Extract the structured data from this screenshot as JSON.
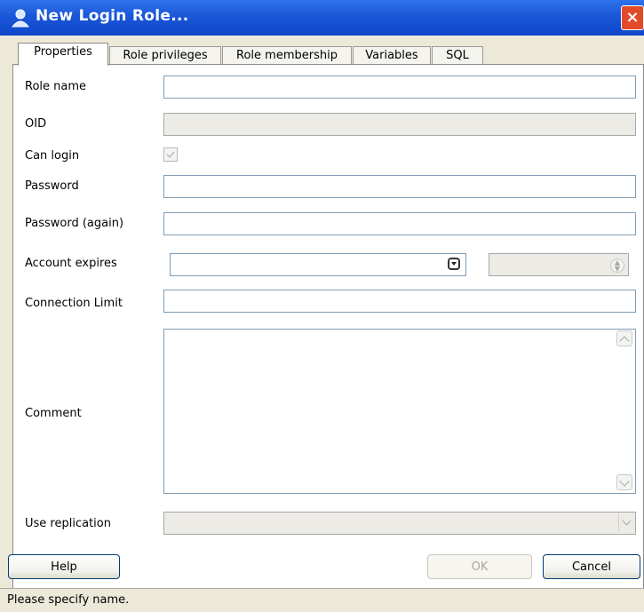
{
  "window": {
    "title": "New Login Role...",
    "close_label": "×"
  },
  "tabs": [
    {
      "label": "Properties",
      "active": true
    },
    {
      "label": "Role privileges",
      "active": false
    },
    {
      "label": "Role membership",
      "active": false
    },
    {
      "label": "Variables",
      "active": false
    },
    {
      "label": "SQL",
      "active": false
    }
  ],
  "form": {
    "role_name_label": "Role name",
    "role_name_value": "",
    "oid_label": "OID",
    "oid_value": "",
    "can_login_label": "Can login",
    "can_login_checked": true,
    "password_label": "Password",
    "password_again_label": "Password (again)",
    "account_expires_label": "Account expires",
    "account_expires_value": "",
    "connection_limit_label": "Connection Limit",
    "connection_limit_value": "",
    "comment_label": "Comment",
    "comment_value": "",
    "use_replication_label": "Use replication",
    "use_replication_value": ""
  },
  "buttons": {
    "help": "Help",
    "ok": "OK",
    "cancel": "Cancel"
  },
  "status": {
    "message": "Please specify name."
  },
  "colors": {
    "titlebar": "#1a57d8",
    "close_button": "#e24a2a",
    "input_border": "#7f9db9",
    "disabled_fill": "#ecebe6"
  },
  "icons": {
    "window_icon": "user-icon",
    "close_icon": "close-icon",
    "dropdown": "chevron-down-icon",
    "spinner": "spinner-icon",
    "scroll_up": "scroll-up-icon",
    "scroll_down": "scroll-down-icon"
  }
}
